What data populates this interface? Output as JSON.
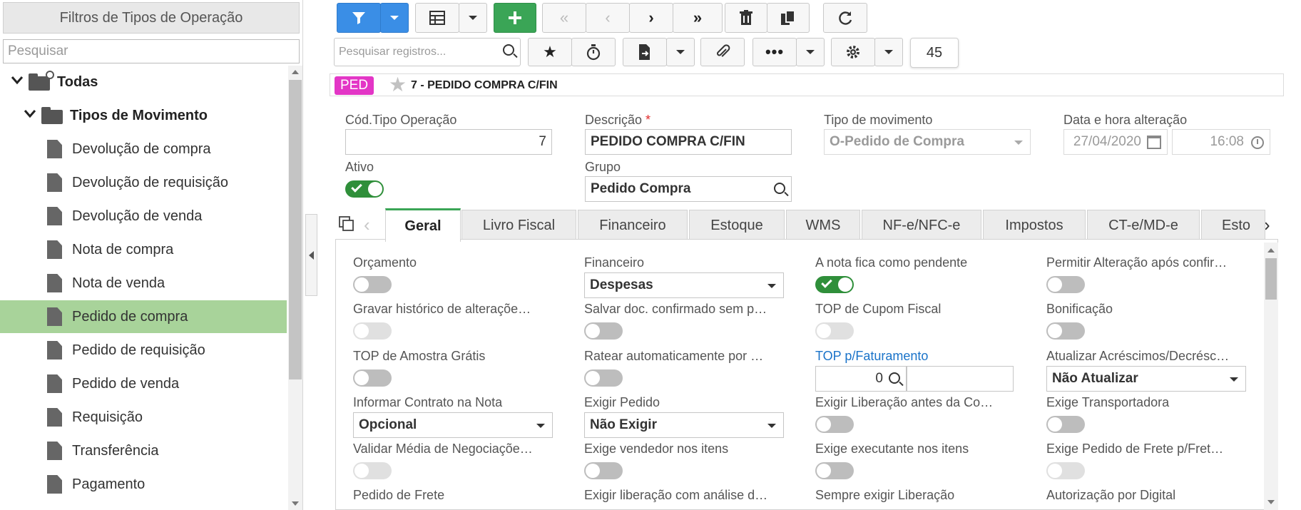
{
  "sidebar": {
    "title": "Filtros de Tipos de Operação",
    "search_placeholder": "Pesquisar",
    "tree": [
      {
        "label": "Todas",
        "level": 0,
        "type": "folder-add"
      },
      {
        "label": "Tipos de Movimento",
        "level": 1,
        "type": "folder"
      },
      {
        "label": "Devolução de compra",
        "level": 2,
        "type": "doc"
      },
      {
        "label": "Devolução de requisição",
        "level": 2,
        "type": "doc"
      },
      {
        "label": "Devolução de venda",
        "level": 2,
        "type": "doc"
      },
      {
        "label": "Nota de compra",
        "level": 2,
        "type": "doc"
      },
      {
        "label": "Nota de venda",
        "level": 2,
        "type": "doc"
      },
      {
        "label": "Pedido de compra",
        "level": 2,
        "type": "doc",
        "selected": true
      },
      {
        "label": "Pedido de requisição",
        "level": 2,
        "type": "doc"
      },
      {
        "label": "Pedido de venda",
        "level": 2,
        "type": "doc"
      },
      {
        "label": "Requisição",
        "level": 2,
        "type": "doc"
      },
      {
        "label": "Transferência",
        "level": 2,
        "type": "doc"
      },
      {
        "label": "Pagamento",
        "level": 2,
        "type": "doc"
      }
    ]
  },
  "toolbar": {
    "search_placeholder": "Pesquisar registros...",
    "record_count": "45",
    "icons": [
      "filter-icon",
      "grid-icon",
      "plus-icon",
      "first-icon",
      "prev-icon",
      "next-icon",
      "last-icon",
      "trash-icon",
      "copy-icon",
      "refresh-icon",
      "search-icon",
      "star-icon",
      "timer-icon",
      "export-icon",
      "paperclip-icon",
      "more-icon",
      "gear-icon"
    ]
  },
  "record": {
    "badge": "PED",
    "title": "7 - PEDIDO COMPRA C/FIN"
  },
  "form": {
    "cod_label": "Cód.Tipo Operação",
    "cod_value": "7",
    "descricao_label": "Descrição",
    "required_mark": "*",
    "descricao_value": "PEDIDO COMPRA C/FIN",
    "tipo_mov_label": "Tipo de movimento",
    "tipo_mov_value": "O-Pedido de Compra",
    "data_label": "Data e hora alteração",
    "data_value": "27/04/2020",
    "hora_value": "16:08",
    "ativo_label": "Ativo",
    "ativo_on": true,
    "grupo_label": "Grupo",
    "grupo_value": "Pedido Compra"
  },
  "tabs": [
    "Geral",
    "Livro Fiscal",
    "Financeiro",
    "Estoque",
    "WMS",
    "NF-e/NFC-e",
    "Impostos",
    "CT-e/MD-e",
    "Esto"
  ],
  "active_tab": "Geral",
  "geral": {
    "orcamento": "Orçamento",
    "financeiro": "Financeiro",
    "financeiro_value": "Despesas",
    "nota_pendente": "A nota fica como pendente",
    "permitir_alt": "Permitir Alteração após confir…",
    "gravar_hist": "Gravar histórico de alteraçõe…",
    "salvar_doc": "Salvar doc. confirmado sem p…",
    "top_cupom": "TOP de Cupom Fiscal",
    "bonificacao": "Bonificação",
    "top_amostra": "TOP de Amostra Grátis",
    "ratear": "Ratear automaticamente por …",
    "top_fat": "TOP p/Faturamento",
    "top_fat_value": "0",
    "atualizar": "Atualizar Acréscimos/Decrésc…",
    "atualizar_value": "Não Atualizar",
    "informar_contrato": "Informar Contrato na Nota",
    "informar_contrato_value": "Opcional",
    "exigir_pedido": "Exigir Pedido",
    "exigir_pedido_value": "Não Exigir",
    "exigir_lib": "Exigir Liberação antes da Co…",
    "exige_transp": "Exige Transportadora",
    "validar_media": "Validar Média de Negociaçõe…",
    "exige_vend": "Exige vendedor nos itens",
    "exige_exec": "Exige executante nos itens",
    "exige_frete": "Exige Pedido de Frete p/Fret…",
    "pedido_frete": "Pedido de Frete",
    "exigir_lib_analise": "Exigir liberação com análise d…",
    "sempre_exigir": "Sempre exigir Liberação",
    "autorizacao": "Autorização por Digital"
  },
  "colors": {
    "primary": "#3a8ee6",
    "green": "#3aa556",
    "badge": "#e336c6",
    "selected": "#a8d39a"
  }
}
